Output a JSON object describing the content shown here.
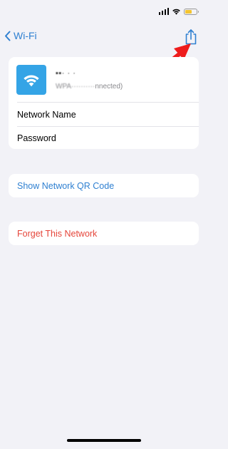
{
  "status_bar": {
    "icons": [
      "signal-icon",
      "wifi-icon",
      "battery-icon"
    ],
    "battery_level": 0.55,
    "battery_color": "#f4c430"
  },
  "nav": {
    "back_label": "Wi-Fi",
    "icons": [
      "chevron-left-icon",
      "share-icon"
    ],
    "accent_color": "#2f80d1"
  },
  "annotation": {
    "icon": "red-arrow-icon",
    "color": "#ee1c1c"
  },
  "network": {
    "name": "▪▪· · ·",
    "status_obscured": "WPA··········",
    "status_visible": "nnected)",
    "tile_color": "#34a4e6",
    "tile_icon": "wifi-icon"
  },
  "rows": {
    "network_name_label": "Network Name",
    "password_label": "Password"
  },
  "actions": {
    "show_qr_label": "Show Network QR Code",
    "forget_label": "Forget This Network",
    "forget_color": "#e5453a"
  }
}
